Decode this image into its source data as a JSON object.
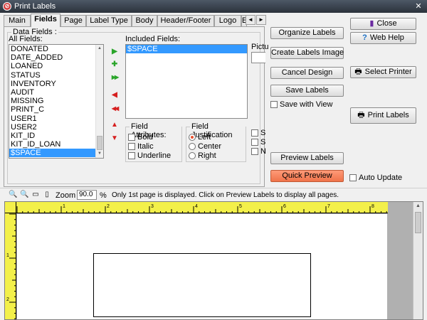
{
  "window": {
    "title": "Print Labels",
    "close_glyph": "✕",
    "icon_glyph": "⊘"
  },
  "tabs": [
    {
      "label": "Main"
    },
    {
      "label": "Fields"
    },
    {
      "label": "Page"
    },
    {
      "label": "Label Type"
    },
    {
      "label": "Body"
    },
    {
      "label": "Header/Footer"
    },
    {
      "label": "Logo"
    },
    {
      "label": "E"
    }
  ],
  "tab_scroll": {
    "left": "◄",
    "right": "►"
  },
  "data_fields": {
    "group_label": "Data Fields :",
    "all_fields_label": "All Fields:",
    "all_fields": [
      "DONATED",
      "DATE_ADDED",
      "LOANED",
      "STATUS",
      "INVENTORY",
      "AUDIT",
      "MISSING",
      "PRINT_C",
      "USER1",
      "USER2",
      "KIT_ID",
      "KIT_ID_LOAN",
      "$SPACE"
    ],
    "all_fields_selected": "$SPACE",
    "included_fields_label": "Included Fields:",
    "included_fields": [
      "$SPACE"
    ],
    "picture_label": "Pictu",
    "arrows": {
      "add": "▶",
      "add_green": "✚",
      "add_all": "▶▶",
      "remove": "◀",
      "remove_all": "◀◀",
      "up": "▲",
      "down": "▼"
    }
  },
  "field_attributes": {
    "label": "Field Attributes:",
    "bold": "Bold",
    "italic": "Italic",
    "underline": "Underline"
  },
  "field_justification": {
    "label": "Field Justification",
    "left": "Left",
    "center": "Center",
    "right": "Right",
    "selected": "Left"
  },
  "side_checks": [
    "S",
    "S",
    "N"
  ],
  "buttons": {
    "organize_labels": "Organize Labels",
    "create_labels_image": "Create Labels Image",
    "cancel_design": "Cancel Design",
    "save_labels": "Save Labels",
    "save_with_view": "Save with View",
    "preview_labels": "Preview Labels",
    "quick_preview": "Quick Preview",
    "auto_update": "Auto Update",
    "close": "Close",
    "web_help": "Web Help",
    "select_printer": "Select Printer",
    "print_labels": "Print Labels"
  },
  "toolbar": {
    "zoom_label": "Zoom",
    "zoom_value": "90.0",
    "percent": "%",
    "hint": "Only 1st page is displayed. Click on Preview Labels to display all pages."
  },
  "ruler": {
    "h_numbers": [
      "1",
      "2",
      "3",
      "4",
      "5",
      "6",
      "7",
      "8"
    ],
    "v_numbers": [
      "1",
      "2"
    ]
  },
  "colors": {
    "accent_selection": "#3399ff",
    "quick_preview": "#f0734a",
    "ruler": "#f3f04a"
  }
}
